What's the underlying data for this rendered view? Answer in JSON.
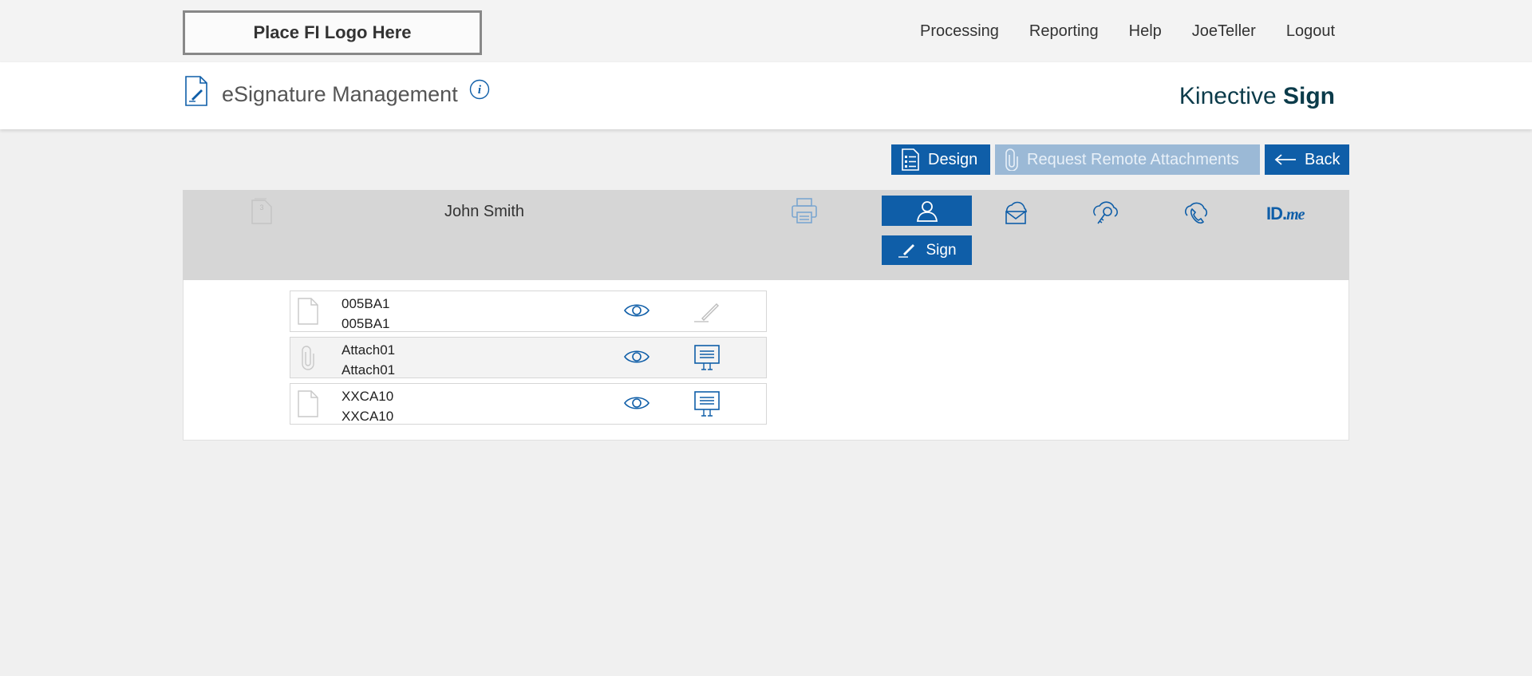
{
  "header": {
    "logo_text": "Place FI Logo Here",
    "nav": [
      "Processing",
      "Reporting",
      "Help",
      "JoeTeller",
      "Logout"
    ]
  },
  "title_bar": {
    "title": "eSignature Management",
    "brand_light": "Kinective ",
    "brand_bold": "Sign"
  },
  "toolbar": {
    "design_label": "Design",
    "remote_label": "Request Remote Attachments",
    "back_label": "Back"
  },
  "signer": {
    "doc_count": "3",
    "name": "John Smith",
    "sign_label": "Sign",
    "idme_id": "ID.",
    "idme_me": "me"
  },
  "documents": [
    {
      "name": "005BA1",
      "subname": "005BA1",
      "type_icon": "document-icon",
      "action_icon": "signature-icon"
    },
    {
      "name": "Attach01",
      "subname": "Attach01",
      "type_icon": "paperclip-icon",
      "action_icon": "present-icon"
    },
    {
      "name": "XXCA10",
      "subname": "XXCA10",
      "type_icon": "document-icon",
      "action_icon": "present-icon"
    }
  ],
  "colors": {
    "primary": "#0f5ea8",
    "disabled": "#9bb9d6",
    "brand_text": "#0b3b4a"
  }
}
